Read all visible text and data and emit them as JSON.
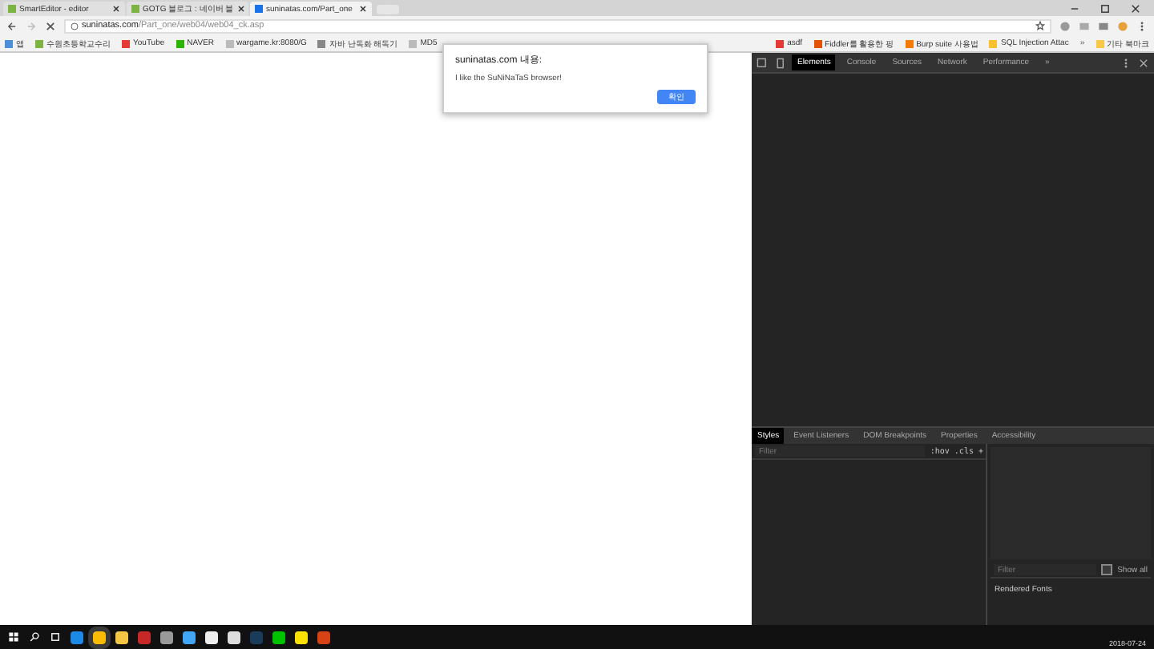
{
  "tabs": [
    {
      "title": "SmartEditor - editor",
      "selected": false
    },
    {
      "title": "GOTG 블로그 : 네이버 블",
      "selected": false
    },
    {
      "title": "suninatas.com/Part_one",
      "selected": true
    }
  ],
  "address_bar": {
    "host": "suninatas.com",
    "path": "/Part_one/web04/web04_ck.asp"
  },
  "bookmarks_left": [
    {
      "label": "앱"
    },
    {
      "label": "수원초등학교수리"
    },
    {
      "label": "YouTube"
    },
    {
      "label": "NAVER"
    },
    {
      "label": "wargame.kr:8080/G"
    },
    {
      "label": "자바 난독화 해독기"
    },
    {
      "label": "MD5"
    }
  ],
  "bookmarks_right": [
    {
      "label": "asdf"
    },
    {
      "label": "Fiddler를 활용한 핑"
    },
    {
      "label": "Burp suite 사용법"
    },
    {
      "label": "SQL Injection Attac"
    }
  ],
  "bookmarks_more": "»",
  "other_bookmarks": "기타 북마크",
  "alert": {
    "title": "suninatas.com 내용:",
    "message": "I like the SuNiNaTaS browser!",
    "button": "확인"
  },
  "devtools": {
    "tabs": [
      {
        "label": "Elements",
        "selected": true
      },
      {
        "label": "Console",
        "selected": false
      },
      {
        "label": "Sources",
        "selected": false
      },
      {
        "label": "Network",
        "selected": false
      },
      {
        "label": "Performance",
        "selected": false
      }
    ],
    "more": "»",
    "lower_tabs": [
      {
        "label": "Styles",
        "selected": true
      },
      {
        "label": "Event Listeners",
        "selected": false
      },
      {
        "label": "DOM Breakpoints",
        "selected": false
      },
      {
        "label": "Properties",
        "selected": false
      },
      {
        "label": "Accessibility",
        "selected": false
      }
    ],
    "styles_filter": {
      "placeholder": "Filter"
    },
    "hov": ":hov",
    "cls": ".cls",
    "add": "+",
    "fonts_filter": {
      "placeholder": "Filter"
    },
    "show_all": {
      "label": "Show all",
      "checked": false
    },
    "rendered_fonts": "Rendered Fonts"
  },
  "taskbar": {
    "date": "2018-07-24"
  }
}
